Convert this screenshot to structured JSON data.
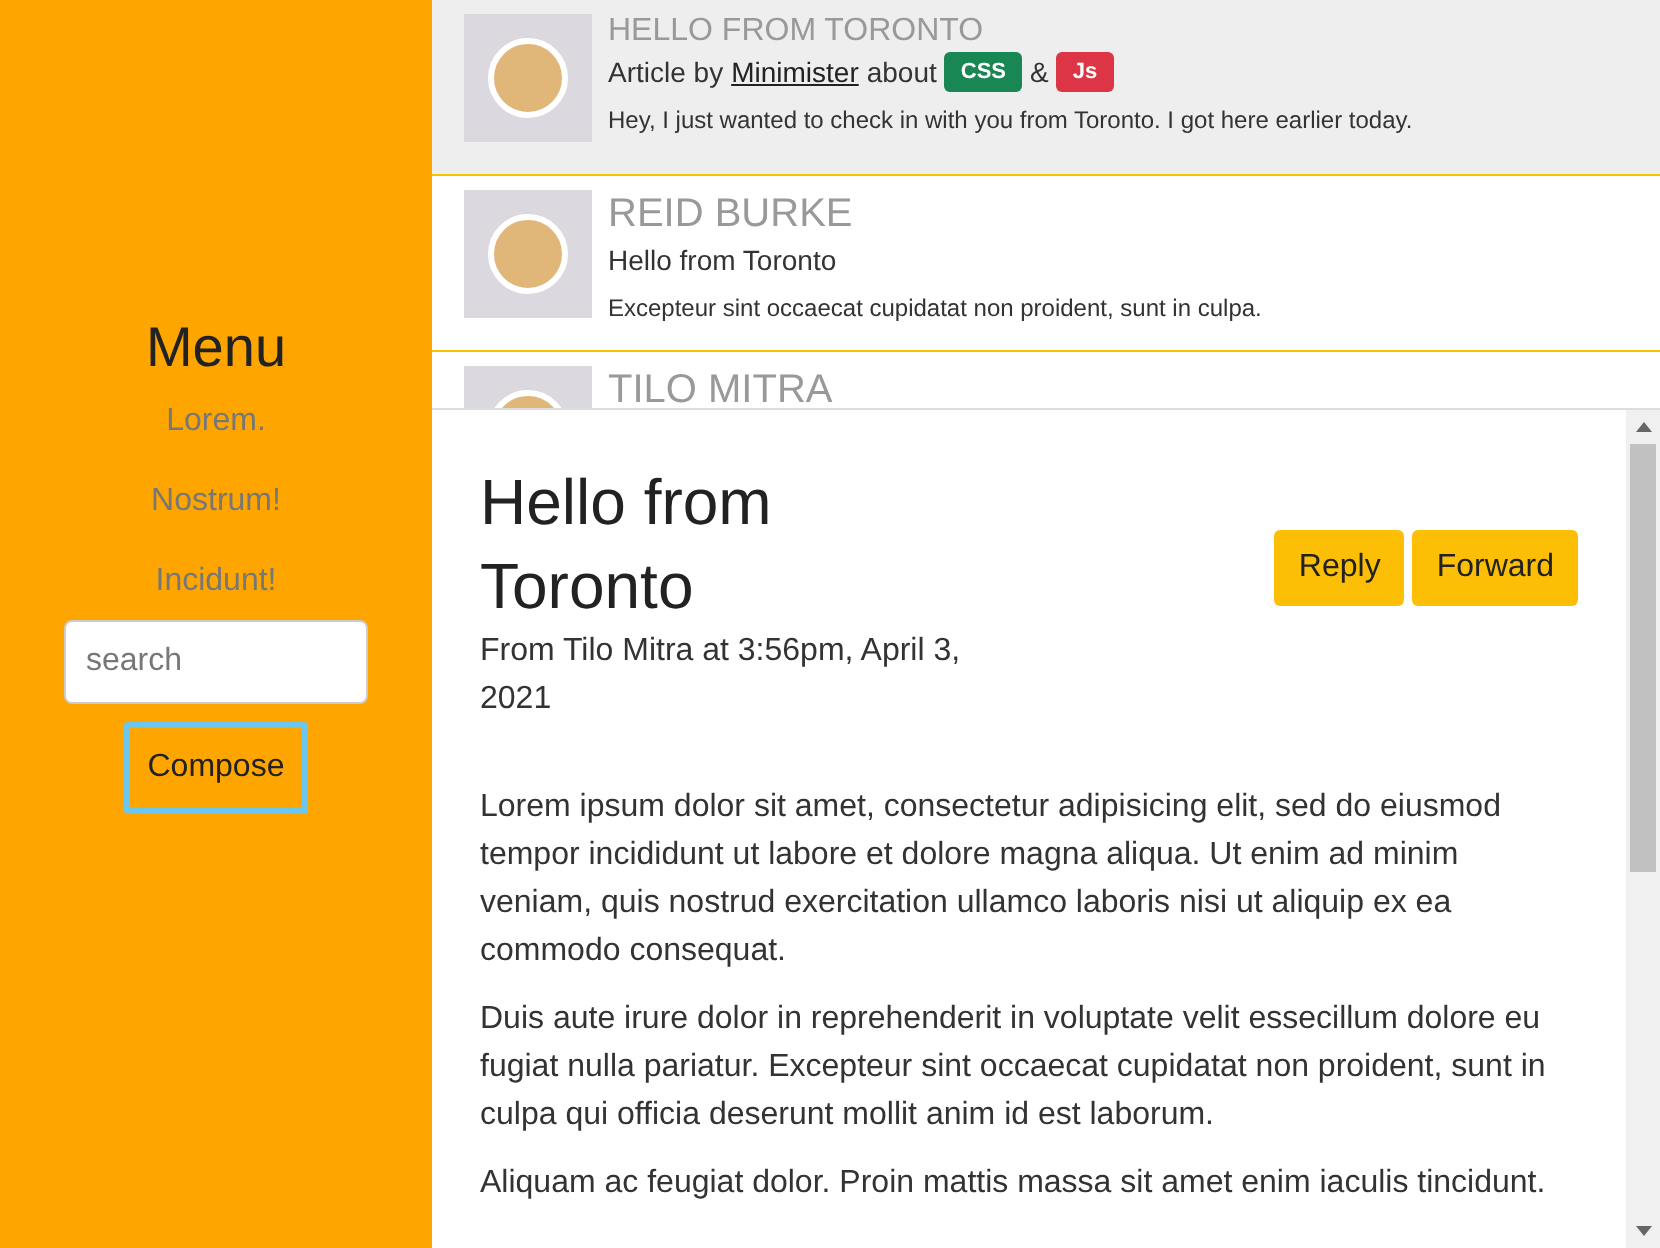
{
  "sidebar": {
    "title": "Menu",
    "items": [
      "Lorem.",
      "Nostrum!",
      "Incidunt!"
    ],
    "search": {
      "placeholder": "search"
    },
    "compose": "Compose"
  },
  "emails": [
    {
      "kind": "article",
      "selected": true,
      "name": "HELLO FROM TORONTO",
      "prefix": "Article by",
      "author": "Minimister",
      "about": "about",
      "tags": [
        {
          "label": "CSS",
          "color": "#198754"
        },
        {
          "label": "Js",
          "color": "#dc3545"
        }
      ],
      "joiner": "&",
      "desc": "Hey, I just wanted to check in with you from Toronto. I got here earlier today."
    },
    {
      "kind": "plain",
      "selected": false,
      "name": "REID BURKE",
      "subject": "Hello from Toronto",
      "desc": "Excepteur sint occaecat cupidatat non proident, sunt in culpa."
    },
    {
      "kind": "plain",
      "selected": false,
      "name": "TILO MITRA"
    }
  ],
  "message": {
    "title": "Hello from Toronto",
    "meta": "From Tilo Mitra at 3:56pm, April 3, 2021",
    "buttons": [
      "Reply",
      "Forward"
    ],
    "paragraphs": [
      "Lorem ipsum dolor sit amet, consectetur adipisicing elit, sed do eiusmod tempor incididunt ut labore et dolore magna aliqua. Ut enim ad minim veniam, quis nostrud exercitation ullamco laboris nisi ut aliquip ex ea commodo consequat.",
      "Duis aute irure dolor in reprehenderit in voluptate velit essecillum dolore eu fugiat nulla pariatur. Excepteur sint occaecat cupidatat non proident, sunt in culpa qui officia deserunt mollit anim id est laborum.",
      "Aliquam ac feugiat dolor. Proin mattis massa sit amet enim iaculis tincidunt."
    ]
  }
}
